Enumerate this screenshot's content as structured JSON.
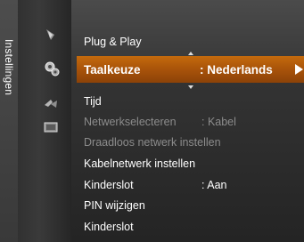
{
  "sidebar": {
    "title": "Instellingen",
    "icons": [
      "picture-icon",
      "settings-icon",
      "satellite-icon",
      "input-icon"
    ]
  },
  "menu": {
    "items": [
      {
        "label": "Plug & Play",
        "value": "",
        "state": "normal"
      },
      {
        "label": "Taalkeuze",
        "value": ": Nederlands",
        "state": "selected"
      },
      {
        "label": "Tijd",
        "value": "",
        "state": "normal"
      },
      {
        "label": "Netwerkselecteren",
        "value": ": Kabel",
        "state": "disabled"
      },
      {
        "label": "Draadloos netwerk instellen",
        "value": "",
        "state": "disabled"
      },
      {
        "label": "Kabelnetwerk instellen",
        "value": "",
        "state": "normal"
      },
      {
        "label": "Kinderslot",
        "value": ": Aan",
        "state": "normal"
      },
      {
        "label": "PIN wijzigen",
        "value": "",
        "state": "normal"
      },
      {
        "label": "Kinderslot",
        "value": "",
        "state": "normal"
      }
    ]
  },
  "colors": {
    "highlight": "#a8530a",
    "menu_bg": "#333333",
    "sidebar_bg": "#2f2f2f",
    "disabled_text": "#8c8c8c"
  }
}
